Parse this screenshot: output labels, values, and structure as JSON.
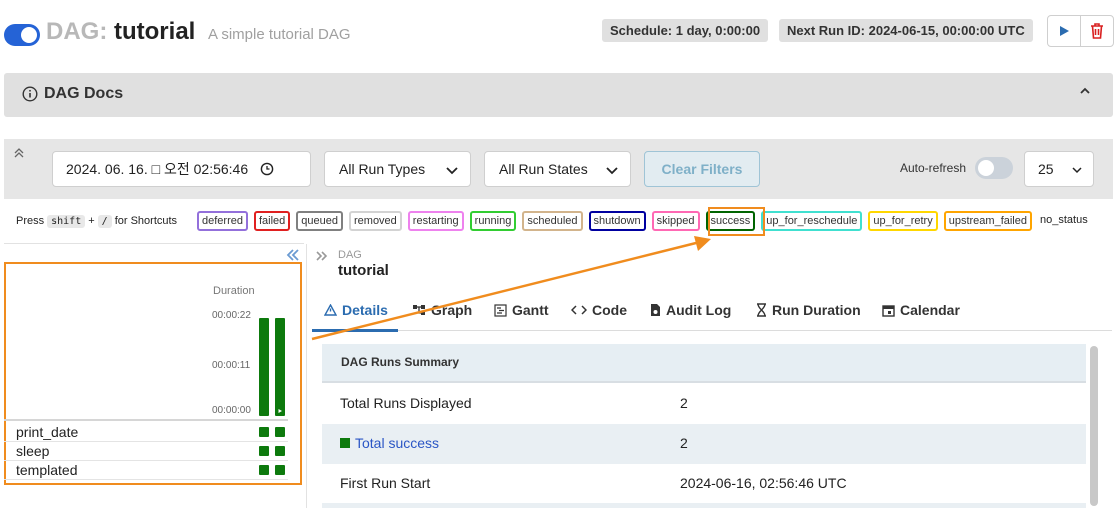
{
  "header": {
    "dag_prefix": "DAG:",
    "dag_name": "tutorial",
    "dag_description": "A simple tutorial DAG",
    "schedule": "Schedule: 1 day, 0:00:00",
    "next_run": "Next Run ID: 2024-06-15, 00:00:00 UTC",
    "trigger_icon": "play-icon",
    "delete_icon": "trash-icon"
  },
  "docs": {
    "label": "DAG Docs"
  },
  "filters": {
    "datetime": "2024. 06. 16.  □ 오전 02:56:46",
    "run_types": "All Run Types",
    "run_states": "All Run States",
    "clear": "Clear Filters",
    "auto_refresh": "Auto-refresh",
    "page_size": "25"
  },
  "shortcuts": {
    "press": "Press",
    "key1": "shift",
    "plus": "+",
    "key2": "/",
    "suffix": "for Shortcuts"
  },
  "states": [
    {
      "label": "deferred",
      "color": "#9370db"
    },
    {
      "label": "failed",
      "color": "#e02020"
    },
    {
      "label": "queued",
      "color": "#808080"
    },
    {
      "label": "removed",
      "color": "#d3d3d3"
    },
    {
      "label": "restarting",
      "color": "#ee82ee"
    },
    {
      "label": "running",
      "color": "#32cd32"
    },
    {
      "label": "scheduled",
      "color": "#d2b48c"
    },
    {
      "label": "shutdown",
      "color": "#0000a0"
    },
    {
      "label": "skipped",
      "color": "#ff69b4"
    },
    {
      "label": "success",
      "color": "#006400"
    },
    {
      "label": "up_for_reschedule",
      "color": "#40e0d0"
    },
    {
      "label": "up_for_retry",
      "color": "#ffd700"
    },
    {
      "label": "upstream_failed",
      "color": "#ffa500"
    }
  ],
  "no_status": "no_status",
  "grid": {
    "duration_label": "Duration",
    "ticks": [
      "00:00:22",
      "00:00:11",
      "00:00:00"
    ],
    "tasks": [
      "print_date",
      "sleep",
      "templated"
    ],
    "run_durations_fraction": [
      1.0,
      1.0
    ]
  },
  "details": {
    "breadcrumb_kind": "DAG",
    "breadcrumb_name": "tutorial",
    "tabs": [
      "Details",
      "Graph",
      "Gantt",
      "Code",
      "Audit Log",
      "Run Duration",
      "Calendar"
    ],
    "table_title": "DAG Runs Summary",
    "rows": [
      {
        "key": "Total Runs Displayed",
        "value": "2"
      },
      {
        "key": "Total success",
        "value": "2"
      },
      {
        "key": "First Run Start",
        "value": "2024-06-16, 02:56:46 UTC"
      }
    ]
  },
  "colors": {
    "accent": "#2563d6",
    "success": "#0d7a0d",
    "highlight": "#f08c1e"
  }
}
